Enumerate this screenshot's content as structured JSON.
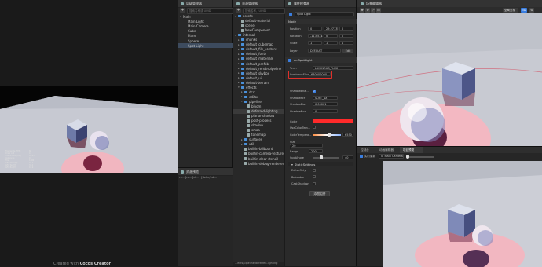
{
  "hierarchy": {
    "title": "层级管理器",
    "search_placeholder": "搜索名称或 UUID",
    "nodes": [
      {
        "label": "Main",
        "depth": 0,
        "arrow": "▾"
      },
      {
        "label": "Main Light",
        "depth": 1,
        "arrow": ""
      },
      {
        "label": "Main Camera",
        "depth": 1,
        "arrow": ""
      },
      {
        "label": "Cube",
        "depth": 1,
        "arrow": ""
      },
      {
        "label": "Plane",
        "depth": 1,
        "arrow": ""
      },
      {
        "label": "Sphere",
        "depth": 1,
        "arrow": ""
      },
      {
        "label": "Spot Light",
        "depth": 1,
        "arrow": ""
      }
    ],
    "selected": 6
  },
  "assets": {
    "title": "资源管理器",
    "search_placeholder": "搜索名称、UUID",
    "items": [
      {
        "label": "assets",
        "depth": 0,
        "type": "folder",
        "arrow": "▾"
      },
      {
        "label": "default-material",
        "depth": 1,
        "type": "file",
        "arrow": ""
      },
      {
        "label": "scene",
        "depth": 1,
        "type": "file",
        "arrow": ""
      },
      {
        "label": "NewComponent",
        "depth": 1,
        "type": "file",
        "arrow": ""
      },
      {
        "label": "internal",
        "depth": 0,
        "type": "folder",
        "arrow": "▾"
      },
      {
        "label": "chunks",
        "depth": 1,
        "type": "folder",
        "arrow": "▸"
      },
      {
        "label": "default_cubemap",
        "depth": 1,
        "type": "folder",
        "arrow": "▸"
      },
      {
        "label": "default_file_content",
        "depth": 1,
        "type": "folder",
        "arrow": "▸"
      },
      {
        "label": "default_fonts",
        "depth": 1,
        "type": "folder",
        "arrow": "▸"
      },
      {
        "label": "default_materials",
        "depth": 1,
        "type": "folder",
        "arrow": "▸"
      },
      {
        "label": "default_prefab",
        "depth": 1,
        "type": "folder",
        "arrow": "▸"
      },
      {
        "label": "default_renderpipeline",
        "depth": 1,
        "type": "folder",
        "arrow": "▸"
      },
      {
        "label": "default_skybox",
        "depth": 1,
        "type": "folder",
        "arrow": "▸"
      },
      {
        "label": "default_ui",
        "depth": 1,
        "type": "folder",
        "arrow": "▸"
      },
      {
        "label": "default-terrain",
        "depth": 1,
        "type": "folder",
        "arrow": "▸"
      },
      {
        "label": "effects",
        "depth": 1,
        "type": "folder",
        "arrow": "▾"
      },
      {
        "label": "dcc",
        "depth": 2,
        "type": "folder",
        "arrow": "▸"
      },
      {
        "label": "editor",
        "depth": 2,
        "type": "folder",
        "arrow": "▸"
      },
      {
        "label": "pipeline",
        "depth": 2,
        "type": "folder",
        "arrow": "▾"
      },
      {
        "label": "bloom",
        "depth": 3,
        "type": "file",
        "arrow": ""
      },
      {
        "label": "deferred-lighting",
        "depth": 3,
        "type": "file",
        "arrow": ""
      },
      {
        "label": "planar-shadow",
        "depth": 3,
        "type": "file",
        "arrow": ""
      },
      {
        "label": "post-process",
        "depth": 3,
        "type": "file",
        "arrow": ""
      },
      {
        "label": "shadow",
        "depth": 3,
        "type": "file",
        "arrow": ""
      },
      {
        "label": "smaa",
        "depth": 3,
        "type": "file",
        "arrow": ""
      },
      {
        "label": "tonemap",
        "depth": 3,
        "type": "file",
        "arrow": ""
      },
      {
        "label": "surfaces",
        "depth": 2,
        "type": "folder",
        "arrow": "▸"
      },
      {
        "label": "util",
        "depth": 2,
        "type": "folder",
        "arrow": "▸"
      },
      {
        "label": "builtin-billboard",
        "depth": 2,
        "type": "file",
        "arrow": ""
      },
      {
        "label": "builtin-camera-texture",
        "depth": 2,
        "type": "file",
        "arrow": ""
      },
      {
        "label": "builtin-clear-stencil",
        "depth": 2,
        "type": "file",
        "arrow": ""
      },
      {
        "label": "builtin-debug-renderer",
        "depth": 2,
        "type": "file",
        "arrow": ""
      }
    ],
    "selected": 20,
    "footer_path": "...ects/pipeline/deferred-lighting"
  },
  "console": {
    "title": "资源预览",
    "toolbar": "rs... [re... [cl... ] [deler/edi..."
  },
  "inspector": {
    "title": "属性检查器",
    "node_name": "Spot Light",
    "node_section": "Node",
    "position": {
      "label": "Position",
      "x": "0",
      "y": "29.2713",
      "z": "0"
    },
    "rotation": {
      "label": "Rotation",
      "x": "-113.531",
      "y": "0",
      "z": "0"
    },
    "scale": {
      "label": "Scale",
      "x": "1",
      "y": "1",
      "z": "1"
    },
    "layer": {
      "label": "Layer",
      "value": "DEFAULT",
      "edit": "Edit"
    },
    "component_title": "cc.SpotLight",
    "term_label": "Term",
    "term_value": "LUMINOUS_FLUX",
    "luminous_label": "LuminousFlux",
    "luminous_value": "680000000",
    "props": [
      {
        "label": "ShadowEna...",
        "kind": "check",
        "value": "✓"
      },
      {
        "label": "ShadowPcf",
        "kind": "select",
        "value": "SOFT_4X"
      },
      {
        "label": "ShadowBias",
        "kind": "text",
        "value": "0.00001"
      },
      {
        "label": "ShadowNor...",
        "kind": "text",
        "value": "0"
      }
    ],
    "color_label": "Color",
    "color_value": "#ff2a2a",
    "use_color_temp": "UseColorTem...",
    "color_temp_label": "ColorTempera...",
    "color_temp_value": "6550",
    "size_label": "Size",
    "size_value": "20",
    "range_label": "Range",
    "range_value": "200",
    "spot_angle_label": "SpotAngle",
    "spot_angle_value": "40",
    "static_title": "StaticSettings",
    "static_items": [
      "EditorOnly",
      "Bakeable",
      "CastShadow"
    ],
    "add_component": "添加组件"
  },
  "scene": {
    "title": "场景编辑器",
    "toolbar_right": "全局坐标",
    "tool_x": "3D"
  },
  "preview": {
    "tabs": [
      "控制台",
      "动画编辑器",
      "项目预览"
    ],
    "active_tab": 2,
    "toolbar_label": "实时更新",
    "camera_select": "0: Main Camera"
  },
  "game_preview": {
    "caption_plain": "Created with",
    "caption_bold": "Cocos Creator",
    "stats": [
      "Framerate (FPS)",
      "Draw call",
      "Frame time (ms)",
      "Instances",
      "Tris",
      "GFX Mem(M)",
      "GFX Tex(M)",
      "GFX Buf(M)"
    ],
    "stat_values": [
      "60",
      "4",
      "16.67",
      "0",
      "1496",
      "44.1",
      "33.2",
      "10.9"
    ]
  },
  "colors": {
    "accent": "#3a7ee0",
    "highlight_border": "#e0302a",
    "spot_pink": "#f5b8c0",
    "floor": "#c7c9d2"
  }
}
